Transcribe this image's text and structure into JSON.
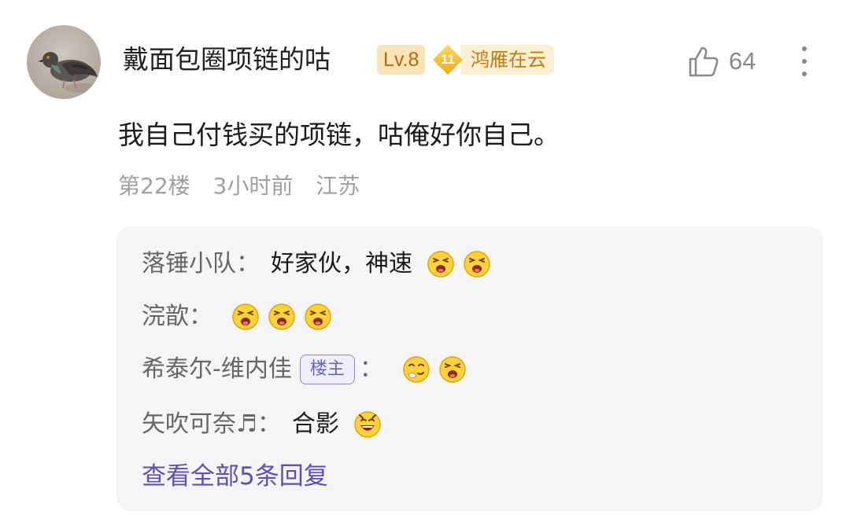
{
  "comment": {
    "username": "戴面包圈项链的咕",
    "level_badge": "Lv.8",
    "fan_badge": {
      "level": "11",
      "name": "鸿雁在云"
    },
    "likes": "64",
    "text": "我自己付钱买的项链，咕俺好你自己。",
    "floor": "第22楼",
    "time": "3小时前",
    "location": "江苏",
    "avatar_icon": "pigeon-avatar",
    "like_icon": "thumbs-up-icon",
    "more_icon": "more-vertical-icon"
  },
  "replies": [
    {
      "name": "落锤小队",
      "sep": "：",
      "text": "好家伙，神速",
      "emojis": [
        "laughing-emoji",
        "laughing-emoji"
      ]
    },
    {
      "name": "浣歆",
      "sep": "：",
      "text": "",
      "emojis": [
        "laughing-emoji",
        "laughing-emoji",
        "laughing-emoji"
      ]
    },
    {
      "name": "希泰尔-维内佳",
      "badge": "楼主",
      "sep": "：",
      "text": "",
      "emojis": [
        "sneaky-emoji",
        "laughing-emoji"
      ]
    },
    {
      "name": "矢吹可奈♬",
      "sep": "：",
      "text": "合影",
      "emojis": [
        "happy-emoji"
      ]
    }
  ],
  "view_all": "查看全部5条回复",
  "colors": {
    "level_badge_bg": "#fbe3b8",
    "level_badge_text": "#b8690a",
    "fan_badge_bg": "#fdf0d2",
    "fan_badge_text": "#c57a12",
    "op_badge": "#6a63c7",
    "link": "#5b4fb8",
    "reply_bg": "#f5f5f7"
  }
}
